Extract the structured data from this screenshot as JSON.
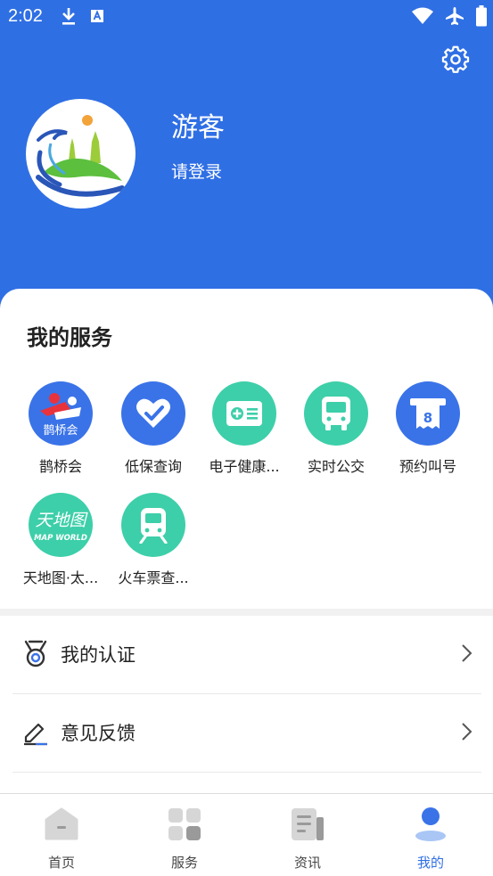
{
  "status_bar": {
    "time": "2:02"
  },
  "profile": {
    "name": "游客",
    "login_prompt": "请登录"
  },
  "services": {
    "title": "我的服务",
    "items": [
      {
        "label": "鹊桥会",
        "icon": "queqiaohui-icon",
        "color": "#3a73e8",
        "badge_text": "鹊桥会"
      },
      {
        "label": "低保查询",
        "icon": "heart-icon",
        "color": "#3a73e8"
      },
      {
        "label": "电子健康...",
        "icon": "health-card-icon",
        "color": "#3dcfa9"
      },
      {
        "label": "实时公交",
        "icon": "bus-icon",
        "color": "#3dcfa9"
      },
      {
        "label": "预约叫号",
        "icon": "queue-ticket-icon",
        "color": "#3a73e8",
        "badge_text": "8"
      },
      {
        "label": "天地图·太...",
        "icon": "tianditu-icon",
        "color": "#3dcfa9",
        "badge_text": "天地图",
        "badge_sub": "MAP WORLD"
      },
      {
        "label": "火车票查...",
        "icon": "train-icon",
        "color": "#3dcfa9"
      }
    ]
  },
  "menu": [
    {
      "label": "我的认证",
      "icon": "medal-icon"
    },
    {
      "label": "意见反馈",
      "icon": "edit-icon"
    }
  ],
  "tabbar": {
    "active": "我的",
    "tabs": [
      {
        "label": "首页",
        "icon": "home-icon"
      },
      {
        "label": "服务",
        "icon": "grid-icon"
      },
      {
        "label": "资讯",
        "icon": "news-icon"
      },
      {
        "label": "我的",
        "icon": "user-icon"
      }
    ]
  },
  "colors": {
    "primary": "#2f6fe4",
    "teal": "#3dcfa9",
    "blue_icon": "#3a73e8"
  }
}
